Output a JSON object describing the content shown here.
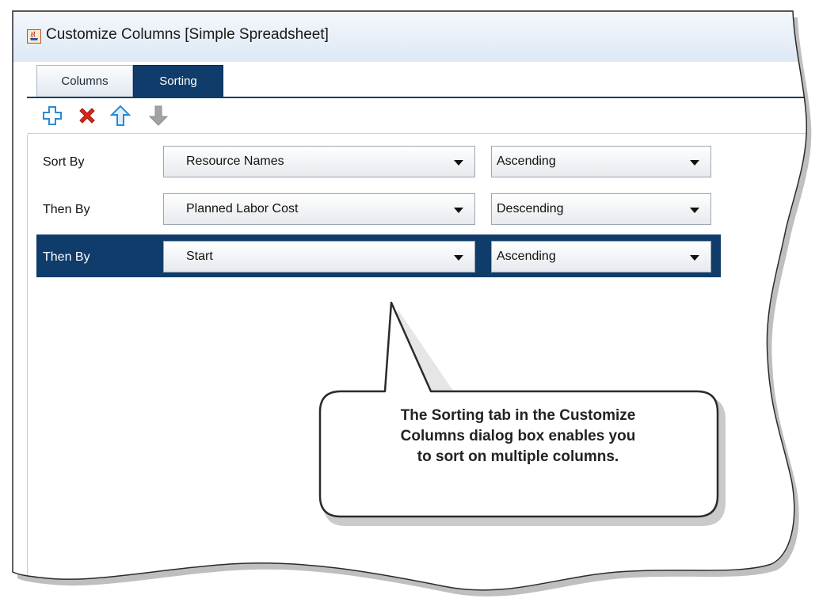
{
  "window": {
    "title": "Customize Columns [Simple Spreadsheet]",
    "icon": "java-app-icon"
  },
  "tabs": [
    {
      "label": "Columns",
      "active": false
    },
    {
      "label": "Sorting",
      "active": true
    }
  ],
  "toolbar": {
    "add_icon": "plus-icon",
    "delete_icon": "delete-x-icon",
    "move_up_icon": "arrow-up-icon",
    "move_down_icon": "arrow-down-icon"
  },
  "sort_rows": [
    {
      "label": "Sort By",
      "column": "Resource Names",
      "order": "Ascending",
      "selected": false
    },
    {
      "label": "Then By",
      "column": "Planned Labor Cost",
      "order": "Descending",
      "selected": false
    },
    {
      "label": "Then By",
      "column": "Start",
      "order": "Ascending",
      "selected": true
    }
  ],
  "callout": {
    "lines": [
      "The Sorting tab in the Customize",
      "Columns dialog box enables you",
      "to sort on multiple columns."
    ]
  },
  "colors": {
    "selected_row": "#0f3c6a",
    "active_tab": "#0f3c6a",
    "add_icon": "#2a8ad4",
    "delete_icon": "#d9261c",
    "up_icon": "#2a8ad4",
    "down_icon": "#9a9a9a"
  }
}
